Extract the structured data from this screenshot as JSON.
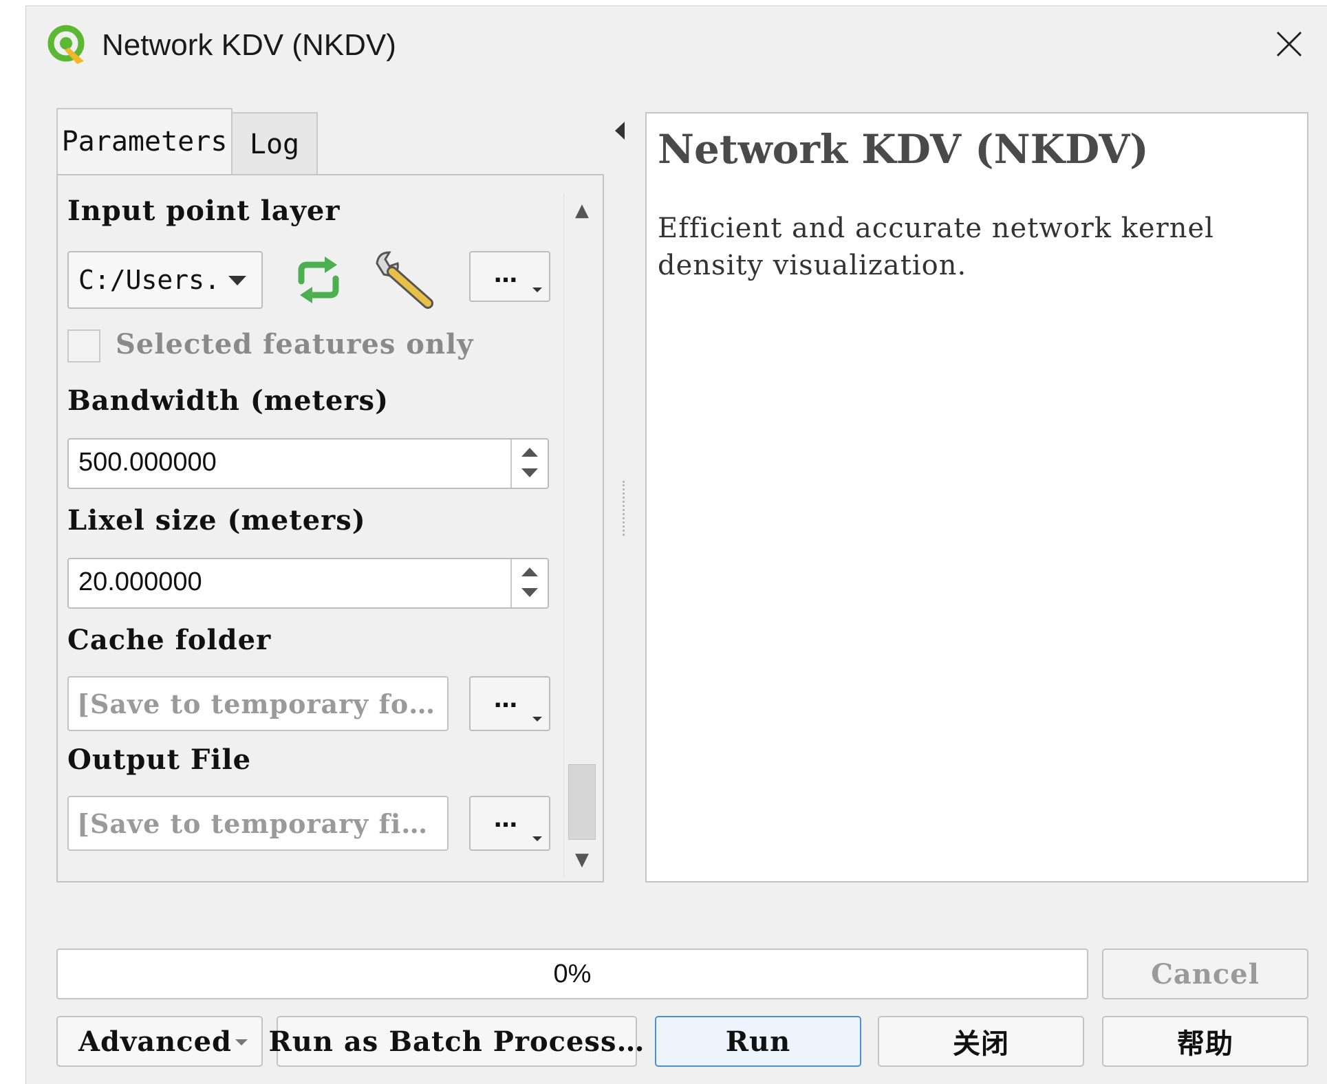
{
  "window": {
    "title": "Network KDV (NKDV)",
    "close_symbol": "✕"
  },
  "tabs": [
    {
      "label": "Parameters",
      "active": true
    },
    {
      "label": "Log",
      "active": false
    }
  ],
  "params": {
    "input_point_layer": {
      "label": "Input point layer",
      "value": "C:/Users.",
      "browse_label": "…"
    },
    "selected_only": {
      "label": "Selected features only",
      "checked": false
    },
    "bandwidth": {
      "label": "Bandwidth (meters)",
      "value": "500.000000"
    },
    "lixel_size": {
      "label": "Lixel size (meters)",
      "value": "20.000000"
    },
    "cache_folder": {
      "label": "Cache folder",
      "placeholder": "[Save to temporary fo…",
      "browse_label": "…"
    },
    "output_file": {
      "label": "Output File",
      "placeholder": "[Save to temporary fi…",
      "browse_label": "…"
    }
  },
  "help": {
    "title": "Network KDV (NKDV)",
    "description": "Efficient and accurate network kernel density visualization."
  },
  "progress": {
    "value": 0,
    "label": "0%"
  },
  "buttons": {
    "cancel": "Cancel",
    "advanced": "Advanced",
    "batch": "Run as Batch Process…",
    "run": "Run",
    "close": "关闭",
    "help": "帮助"
  },
  "colors": {
    "accent": "#2d9cdb",
    "qgis_green": "#5bb833",
    "qgis_yellow": "#f0b72e",
    "refresh_green": "#4caf50"
  }
}
